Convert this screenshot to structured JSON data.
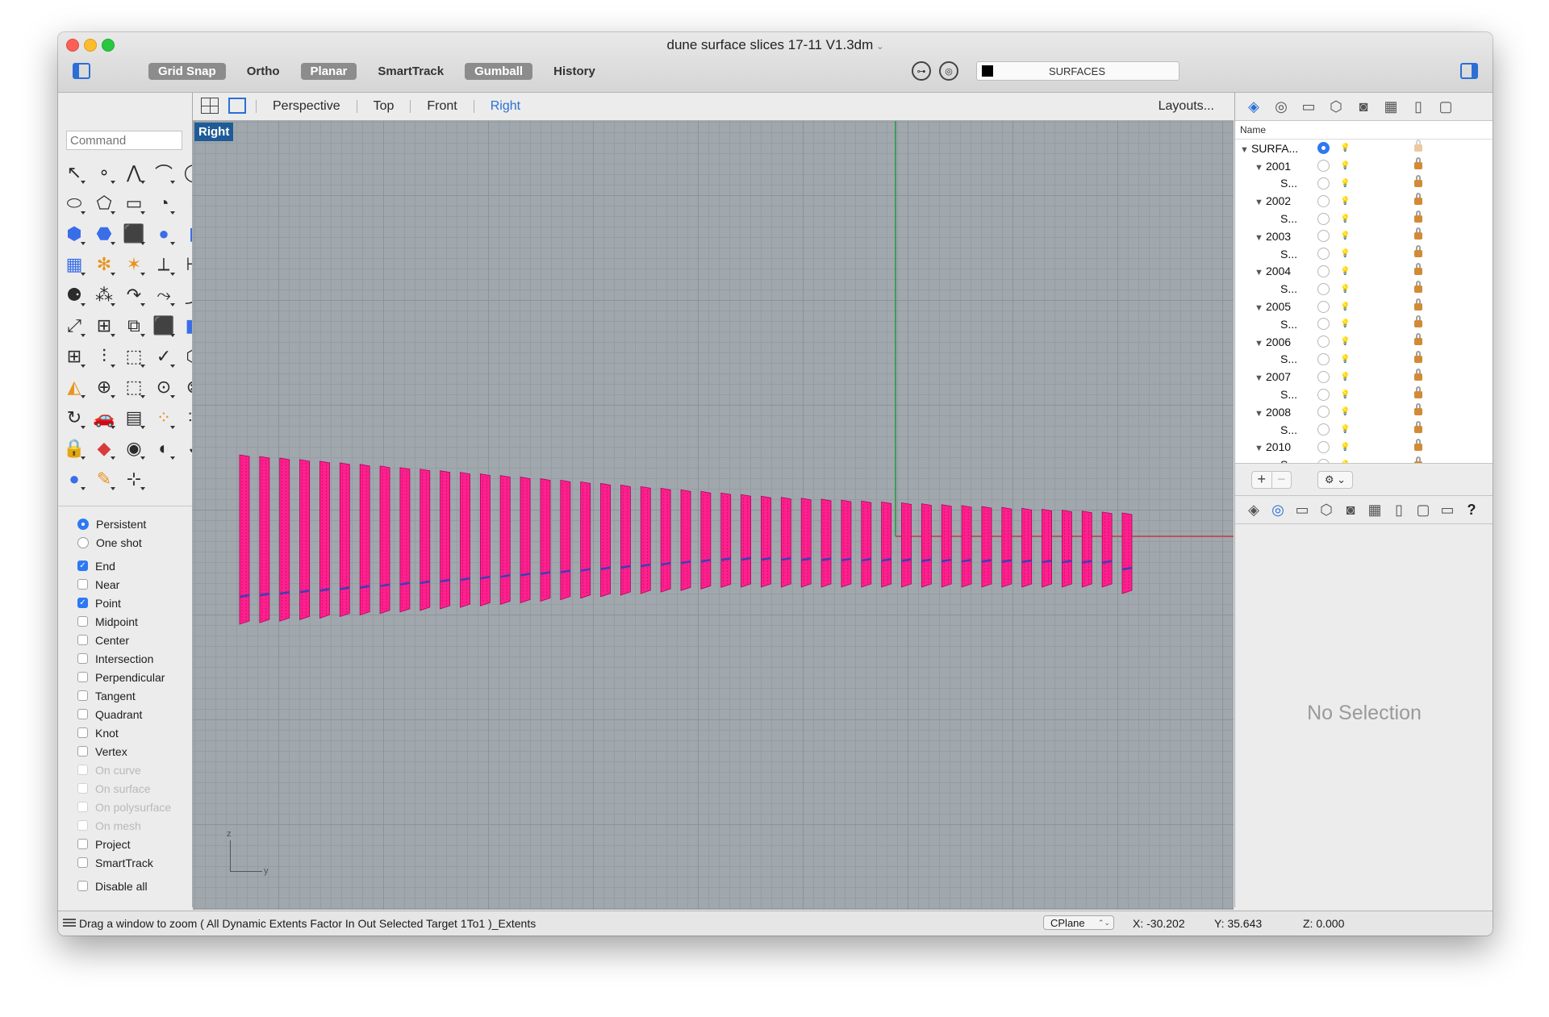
{
  "window": {
    "title": "dune surface slices 17-11 V1.3dm"
  },
  "toolbar": {
    "modes": [
      {
        "label": "Grid Snap",
        "on": true
      },
      {
        "label": "Ortho",
        "on": false
      },
      {
        "label": "Planar",
        "on": true
      },
      {
        "label": "SmartTrack",
        "on": false
      },
      {
        "label": "Gumball",
        "on": true
      },
      {
        "label": "History",
        "on": false
      }
    ],
    "current_layer": "SURFACES",
    "layer_color": "#000000"
  },
  "command": {
    "placeholder": "Command"
  },
  "tools": [
    "select-arrow-icon",
    "point-icon",
    "polyline-icon",
    "curve-icon",
    "circle-icon",
    "ellipse-icon",
    "polygon-icon",
    "rectangle-icon",
    "arc-icon",
    "arc-alt-icon",
    "surface-icon",
    "surface-patch-icon",
    "box-icon",
    "sphere-icon",
    "cylinder-icon",
    "mesh-icon",
    "gear-transform-icon",
    "explode-icon",
    "trim-icon",
    "split-icon",
    "boolean-icon",
    "group-icon",
    "fillet-icon",
    "blend-icon",
    "blend-alt-icon",
    "move-icon",
    "array-icon",
    "transform-icon",
    "solid-edit-icon",
    "solid-alt-icon",
    "grid-array-icon",
    "align-icon",
    "scale-icon",
    "checkmark-icon",
    "cage-icon",
    "named-view-icon",
    "zoom-icon",
    "zoom-window-icon",
    "zoom-extents-icon",
    "zoom-alt-icon",
    "rotate-view-icon",
    "car-icon",
    "render-grid-icon",
    "points-on-icon",
    "points-alt-icon",
    "lock-icon",
    "render-material-icon",
    "color-wheel-icon",
    "environment-icon",
    "environment-alt-icon",
    "render-sphere-icon",
    "pen-icon",
    "dimension-icon"
  ],
  "osnap": {
    "modes": [
      {
        "label": "Persistent",
        "selected": true
      },
      {
        "label": "One shot",
        "selected": false
      }
    ],
    "snaps": [
      {
        "label": "End",
        "checked": true,
        "enabled": true
      },
      {
        "label": "Near",
        "checked": false,
        "enabled": true
      },
      {
        "label": "Point",
        "checked": true,
        "enabled": true
      },
      {
        "label": "Midpoint",
        "checked": false,
        "enabled": true
      },
      {
        "label": "Center",
        "checked": false,
        "enabled": true
      },
      {
        "label": "Intersection",
        "checked": false,
        "enabled": true
      },
      {
        "label": "Perpendicular",
        "checked": false,
        "enabled": true
      },
      {
        "label": "Tangent",
        "checked": false,
        "enabled": true
      },
      {
        "label": "Quadrant",
        "checked": false,
        "enabled": true
      },
      {
        "label": "Knot",
        "checked": false,
        "enabled": true
      },
      {
        "label": "Vertex",
        "checked": false,
        "enabled": true
      },
      {
        "label": "On curve",
        "checked": false,
        "enabled": false
      },
      {
        "label": "On surface",
        "checked": false,
        "enabled": false
      },
      {
        "label": "On polysurface",
        "checked": false,
        "enabled": false
      },
      {
        "label": "On mesh",
        "checked": false,
        "enabled": false
      },
      {
        "label": "Project",
        "checked": false,
        "enabled": true
      },
      {
        "label": "SmartTrack",
        "checked": false,
        "enabled": true
      }
    ],
    "disable_all": "Disable all"
  },
  "viewport_tabs": {
    "tabs": [
      "Perspective",
      "Top",
      "Front",
      "Right"
    ],
    "active": "Right",
    "layouts": "Layouts..."
  },
  "viewport": {
    "label": "Right",
    "axis_z": "z",
    "axis_y": "y",
    "object_color": "#ff1f8e",
    "slice_count": 45
  },
  "layers_panel": {
    "name_header": "Name",
    "rows": [
      {
        "name": "SURFA...",
        "level": 0,
        "expanded": true,
        "current": true
      },
      {
        "name": "2001",
        "level": 1,
        "expanded": true
      },
      {
        "name": "S...",
        "level": 2
      },
      {
        "name": "2002",
        "level": 1,
        "expanded": true
      },
      {
        "name": "S...",
        "level": 2
      },
      {
        "name": "2003",
        "level": 1,
        "expanded": true
      },
      {
        "name": "S...",
        "level": 2
      },
      {
        "name": "2004",
        "level": 1,
        "expanded": true
      },
      {
        "name": "S...",
        "level": 2
      },
      {
        "name": "2005",
        "level": 1,
        "expanded": true
      },
      {
        "name": "S...",
        "level": 2
      },
      {
        "name": "2006",
        "level": 1,
        "expanded": true
      },
      {
        "name": "S...",
        "level": 2
      },
      {
        "name": "2007",
        "level": 1,
        "expanded": true
      },
      {
        "name": "S...",
        "level": 2
      },
      {
        "name": "2008",
        "level": 1,
        "expanded": true
      },
      {
        "name": "S...",
        "level": 2
      },
      {
        "name": "2010",
        "level": 1,
        "expanded": true
      },
      {
        "name": "S...",
        "level": 2
      }
    ],
    "add": "+",
    "remove": "−",
    "gear": "⚙ ⌄"
  },
  "properties_panel": {
    "empty_text": "No Selection"
  },
  "status": {
    "prompt": "Drag a window to zoom ( All Dynamic Extents Factor In Out Selected Target 1To1 )_Extents",
    "cplane": "CPlane",
    "x": "X: -30.202",
    "y": "Y: 35.643",
    "z": "Z: 0.000"
  }
}
